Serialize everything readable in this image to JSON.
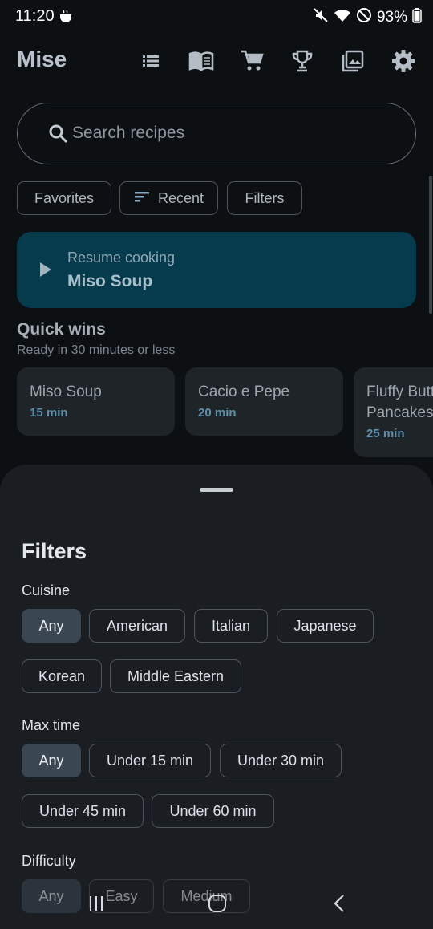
{
  "status": {
    "time": "11:20",
    "battery": "93%"
  },
  "app": {
    "title": "Mise"
  },
  "toolbar": {
    "icons": [
      "list-icon",
      "book-icon",
      "cart-icon",
      "trophy-icon",
      "gallery-icon",
      "settings-icon"
    ]
  },
  "search": {
    "placeholder": "Search recipes",
    "value": ""
  },
  "top_chips": {
    "favorites": "Favorites",
    "recent": "Recent",
    "filters": "Filters"
  },
  "resume": {
    "label": "Resume cooking",
    "title": "Miso Soup"
  },
  "quick_wins": {
    "title": "Quick wins",
    "subtitle": "Ready in 30 minutes or less",
    "items": [
      {
        "name": "Miso Soup",
        "time": "15 min"
      },
      {
        "name": "Cacio e Pepe",
        "time": "20 min"
      },
      {
        "name_line1": "Fluffy Butt",
        "name_line2": "Pancakes",
        "time": "25 min"
      }
    ]
  },
  "filters": {
    "title": "Filters",
    "cuisine": {
      "label": "Cuisine",
      "selected": "Any",
      "options": [
        "Any",
        "American",
        "Italian",
        "Japanese",
        "Korean",
        "Middle Eastern"
      ]
    },
    "max_time": {
      "label": "Max time",
      "selected": "Any",
      "options": [
        "Any",
        "Under 15 min",
        "Under 30 min",
        "Under 45 min",
        "Under 60 min"
      ]
    },
    "difficulty": {
      "label": "Difficulty",
      "selected": "Any",
      "options": [
        "Any",
        "Easy",
        "Medium"
      ]
    }
  },
  "colors": {
    "background": "#0d1013",
    "sheet": "#1a1e22",
    "resume_card": "#063a4d",
    "accent_time": "#5e8fab",
    "selected_chip": "#3a4752"
  }
}
